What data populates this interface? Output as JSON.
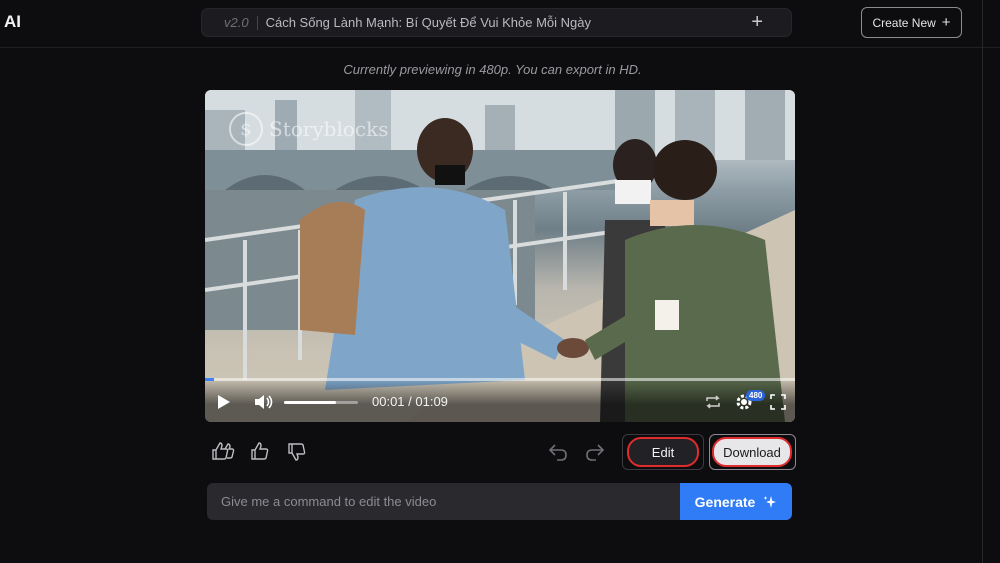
{
  "app": {
    "logo": "AI"
  },
  "header": {
    "version": "v2.0",
    "title": "Cách Sống Lành Mạnh: Bí Quyết Để Vui Khỏe Mỗi Ngày",
    "create_new_label": "Create New"
  },
  "preview": {
    "note": "Currently previewing in 480p. You can export in HD."
  },
  "video": {
    "watermark": "Storyblocks",
    "time": "00:01 / 01:09",
    "progress_fraction": 0.015,
    "volume_fraction": 0.7,
    "quality_badge": "480"
  },
  "actions": {
    "edit_label": "Edit",
    "download_label": "Download"
  },
  "command": {
    "placeholder": "Give me a command to edit the video",
    "generate_label": "Generate"
  },
  "colors": {
    "accent_blue": "#2f7cf6",
    "highlight_red": "#e02c2c",
    "background": "#0d0d0f"
  }
}
